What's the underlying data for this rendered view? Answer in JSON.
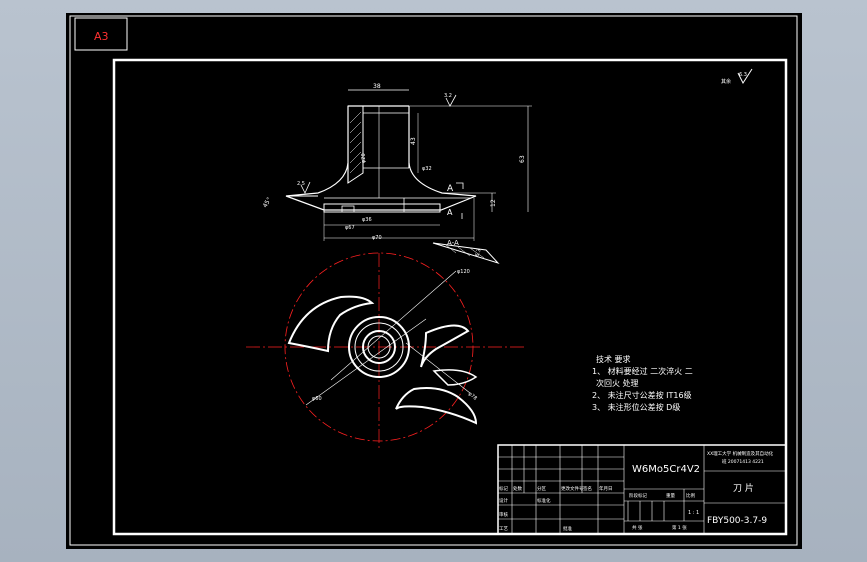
{
  "sheet_label": "A3",
  "surface_symbol": "6.3",
  "top_roughness": "3.2",
  "dims": {
    "top_width": "38",
    "height_total": "63",
    "height_upper": "43",
    "height_blade": "12",
    "angle": "45°",
    "dia_inner": "φ32",
    "dia_bore": "φ20",
    "dia_hub": "φ36",
    "dia_mid": "φ67",
    "dia_outer": "φ70",
    "rough_left": "2.5",
    "rough_side": "6.3",
    "section_label": "A",
    "section_view": "A-A",
    "dia_r120": "φ120",
    "dia_r60": "φ60",
    "dia_r78": "φ78"
  },
  "notes": {
    "title": "技术 要求",
    "items": [
      "1、 材料要经过 二次淬火 二",
      "次回火 处理",
      "2、 未注尺寸公差按 IT16级",
      "3、 未注形位公差按 D级"
    ]
  },
  "title_block": {
    "material": "W6Mo5Cr4V2",
    "school": "XX理工大学 机械制造及其自动化",
    "class_no": "班 20071413 4221",
    "part_name": "刀 片",
    "drawing_no": "FBY500-3.7-9",
    "scale": "1 : 1",
    "sheet": "第 1 张",
    "labels": {
      "mark": "标记",
      "count": "处数",
      "zone": "分区",
      "change_doc": "更改文件号",
      "sign": "签名",
      "date": "年月日",
      "design": "设计",
      "standard": "标准化",
      "review": "审核",
      "process": "工艺",
      "approve": "批准",
      "stage": "阶段标记",
      "weight": "重量",
      "ratio": "比例",
      "total": "共 张"
    }
  }
}
